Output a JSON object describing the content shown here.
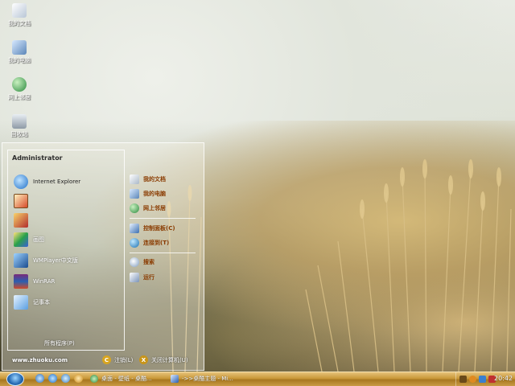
{
  "desktop": {
    "icons": [
      {
        "label": "我的文档",
        "icon": "my-documents-icon"
      },
      {
        "label": "我的电脑",
        "icon": "my-computer-icon"
      },
      {
        "label": "网上邻居",
        "icon": "network-places-icon"
      },
      {
        "label": "回收站",
        "icon": "recycle-bin-icon"
      }
    ]
  },
  "start_menu": {
    "user_name": "Administrator",
    "pinned": [
      {
        "label": "Internet Explorer",
        "icon": "internet-explorer-icon"
      },
      {
        "label": "",
        "icon": "app-icon-1"
      },
      {
        "label": "",
        "icon": "app-icon-2"
      },
      {
        "label": "画图",
        "icon": "paint-icon"
      },
      {
        "label": "WMPlayer中文版",
        "icon": "media-player-icon"
      },
      {
        "label": "WinRAR",
        "icon": "winrar-icon"
      },
      {
        "label": "记事本",
        "icon": "notepad-icon"
      }
    ],
    "all_programs": "所有程序(P)",
    "right_items": [
      {
        "label": "我的文档",
        "icon": "my-documents-icon"
      },
      {
        "label": "我的电脑",
        "icon": "my-computer-icon"
      },
      {
        "label": "网上邻居",
        "icon": "network-places-icon"
      },
      {
        "label": "控制面板(C)",
        "icon": "control-panel-icon"
      },
      {
        "label": "连接到(T)",
        "icon": "connect-to-icon"
      },
      {
        "label": "搜索",
        "icon": "search-icon"
      },
      {
        "label": "运行",
        "icon": "run-icon"
      }
    ],
    "footer_url": "www.zhuoku.com",
    "logoff_label": "注销(L)",
    "shutdown_label": "关闭计算机(U)"
  },
  "taskbar": {
    "tasks": [
      {
        "label": "桌面 - 壁纸 - 桌酷...",
        "icon": "ie-task-icon"
      },
      {
        "label": "->>桌酷主题 - Mi...",
        "icon": "word-task-icon"
      }
    ],
    "clock": "20:42"
  },
  "colors": {
    "taskbar": "#c99838",
    "menu_link": "#8a3b00"
  }
}
